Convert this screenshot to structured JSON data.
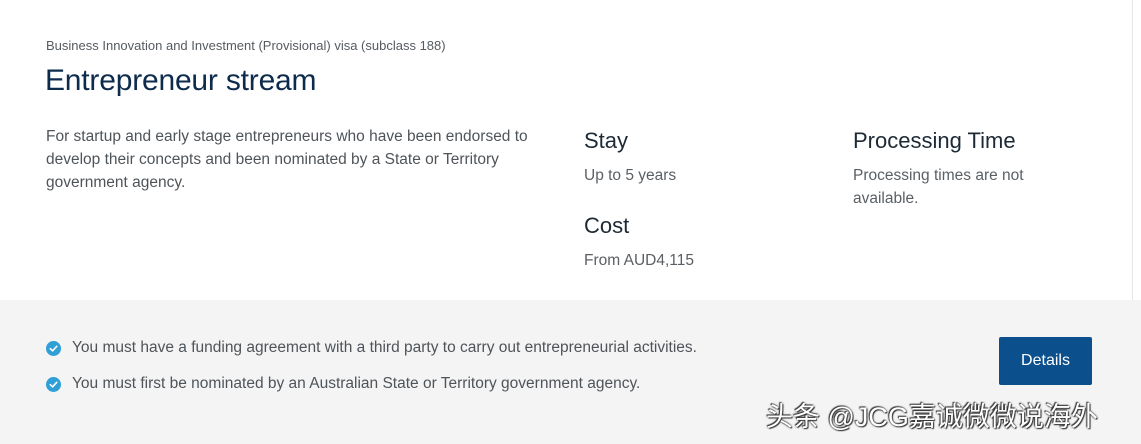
{
  "header": {
    "subtitle": "Business Innovation and Investment (Provisional) visa (subclass 188)",
    "title": "Entrepreneur stream",
    "description": "For startup and early stage entrepreneurs who have been endorsed to develop their concepts and been nominated by a State or Territory government agency."
  },
  "info": {
    "stay_heading": "Stay",
    "stay_value": "Up to 5 years",
    "cost_heading": "Cost",
    "cost_value": "From AUD4,115",
    "processing_heading": "Processing Time",
    "processing_value": "Processing times are not available."
  },
  "requirements": [
    {
      "text": "You must have a funding agreement with a third party to carry out entrepreneurial activities.",
      "icon": "check-circle-icon"
    },
    {
      "text": "You must first be nominated by an Australian State or Territory government agency.",
      "icon": "check-circle-icon"
    }
  ],
  "actions": {
    "details_label": "Details"
  },
  "watermark": "头条 @JCG嘉诚微微说海外",
  "colors": {
    "title": "#0d2b4c",
    "button": "#0b4f8c",
    "check": "#2f9fd6",
    "footer_bg": "#f4f4f4"
  }
}
